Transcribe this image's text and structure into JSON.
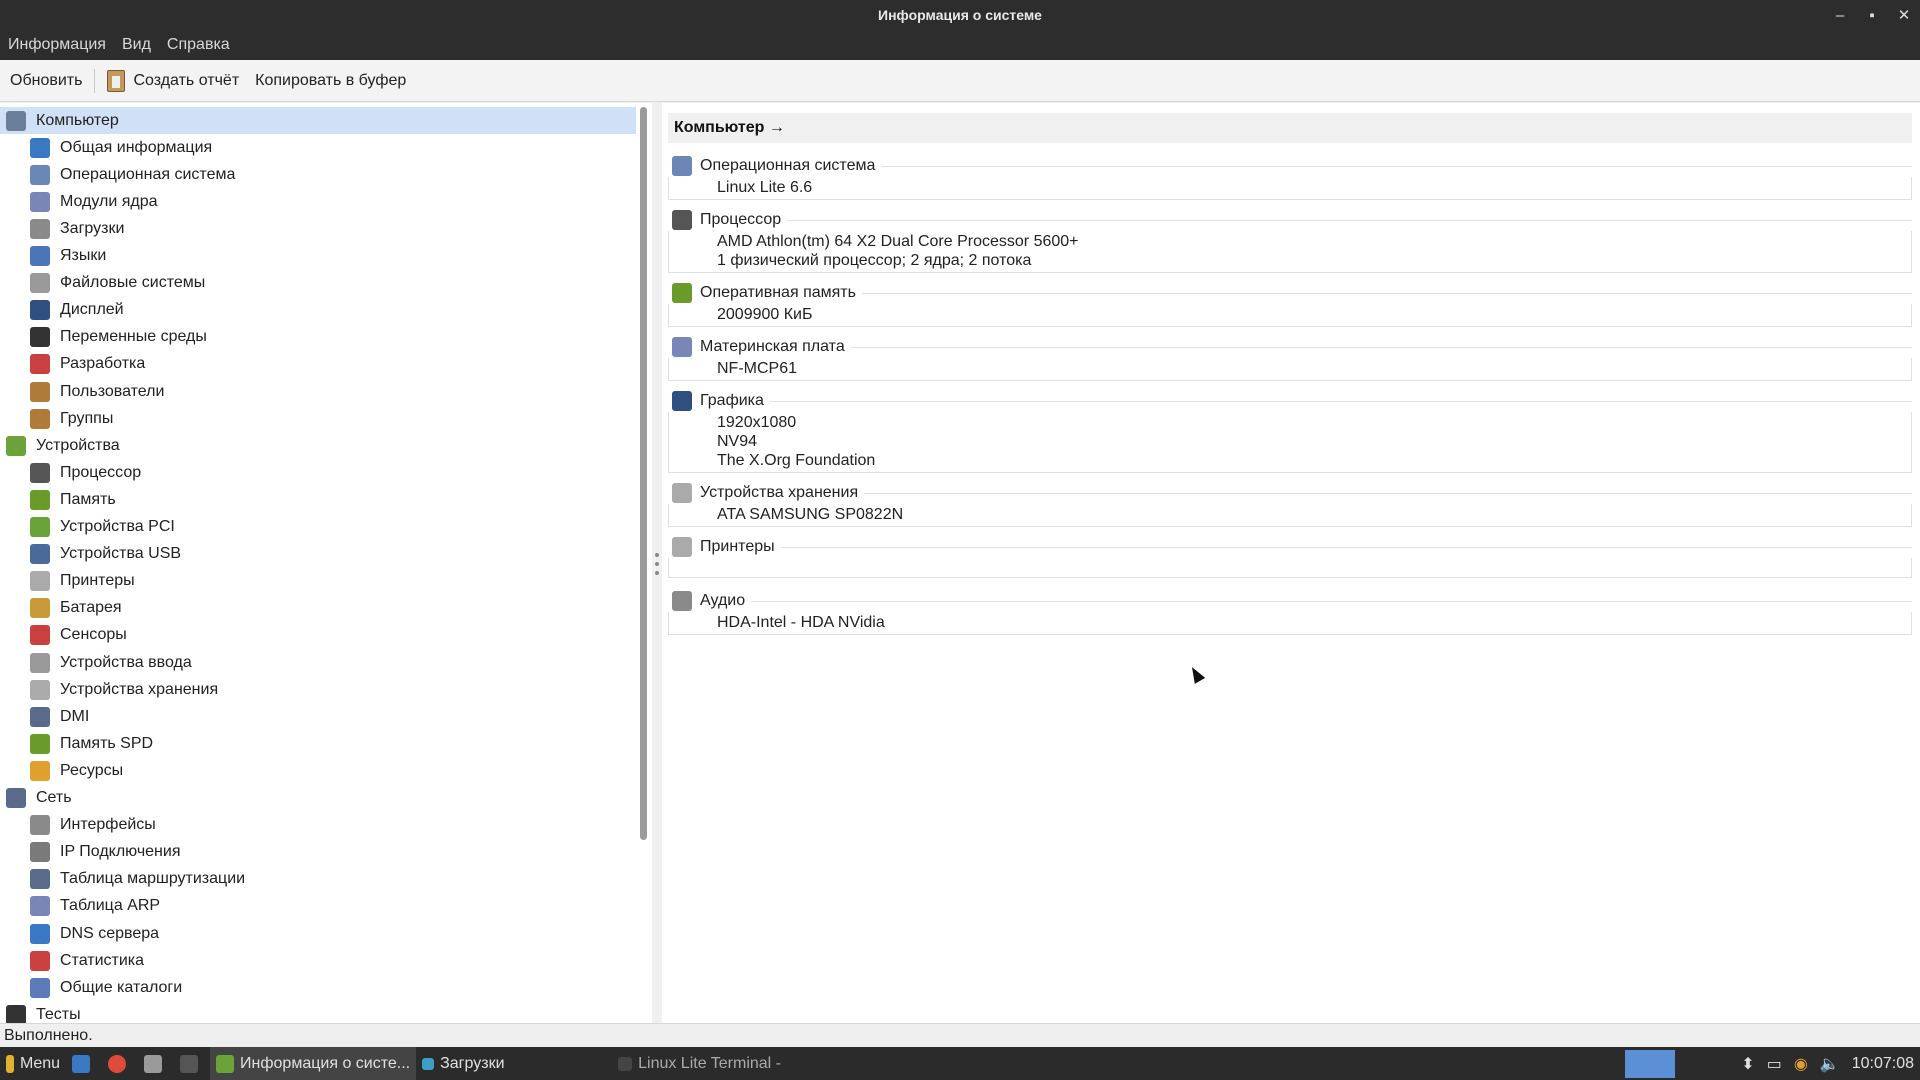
{
  "window": {
    "title": "Информация о системе"
  },
  "menu": [
    "Информация",
    "Вид",
    "Справка"
  ],
  "toolbar": {
    "refresh": "Обновить",
    "report": "Создать отчёт",
    "copy": "Копировать в буфер"
  },
  "tree": [
    {
      "label": "Компьютер",
      "level": 0,
      "icon": "computer-icon",
      "color": "#6b7f99",
      "selected": true
    },
    {
      "label": "Общая информация",
      "level": 1,
      "icon": "info-icon",
      "color": "#3b78c4"
    },
    {
      "label": "Операционная система",
      "level": 1,
      "icon": "gear-icon",
      "color": "#6a87b5"
    },
    {
      "label": "Модули ядра",
      "level": 1,
      "icon": "diamond-icon",
      "color": "#7a86b8"
    },
    {
      "label": "Загрузки",
      "level": 1,
      "icon": "power-icon",
      "color": "#8a8a8a"
    },
    {
      "label": "Языки",
      "level": 1,
      "icon": "flag-icon",
      "color": "#4a76b8"
    },
    {
      "label": "Файловые системы",
      "level": 1,
      "icon": "drive-icon",
      "color": "#9a9a9a"
    },
    {
      "label": "Дисплей",
      "level": 1,
      "icon": "monitor-icon",
      "color": "#2f4f80"
    },
    {
      "label": "Переменные среды",
      "level": 1,
      "icon": "terminal-icon",
      "color": "#333333"
    },
    {
      "label": "Разработка",
      "level": 1,
      "icon": "dev-icon",
      "color": "#c84040"
    },
    {
      "label": "Пользователи",
      "level": 1,
      "icon": "users-icon",
      "color": "#b07a3a"
    },
    {
      "label": "Группы",
      "level": 1,
      "icon": "groups-icon",
      "color": "#b07a3a"
    },
    {
      "label": "Устройства",
      "level": 0,
      "icon": "board-icon",
      "color": "#6aa33a"
    },
    {
      "label": "Процессор",
      "level": 1,
      "icon": "cpu-icon",
      "color": "#555555"
    },
    {
      "label": "Память",
      "level": 1,
      "icon": "memory-icon",
      "color": "#6a9a2a"
    },
    {
      "label": "Устройства PCI",
      "level": 1,
      "icon": "pci-icon",
      "color": "#6aa33a"
    },
    {
      "label": "Устройства USB",
      "level": 1,
      "icon": "usb-icon",
      "color": "#4a6a9a"
    },
    {
      "label": "Принтеры",
      "level": 1,
      "icon": "printer-icon",
      "color": "#aaaaaa"
    },
    {
      "label": "Батарея",
      "level": 1,
      "icon": "battery-icon",
      "color": "#c89a3a"
    },
    {
      "label": "Сенсоры",
      "level": 1,
      "icon": "thermometer-icon",
      "color": "#c84040"
    },
    {
      "label": "Устройства ввода",
      "level": 1,
      "icon": "input-icon",
      "color": "#9a9a9a"
    },
    {
      "label": "Устройства хранения",
      "level": 1,
      "icon": "storage-icon",
      "color": "#aaaaaa"
    },
    {
      "label": "DMI",
      "level": 1,
      "icon": "dmi-icon",
      "color": "#5a6a8a"
    },
    {
      "label": "Память SPD",
      "level": 1,
      "icon": "spd-icon",
      "color": "#6a9a2a"
    },
    {
      "label": "Ресурсы",
      "level": 1,
      "icon": "resources-icon",
      "color": "#e0a030"
    },
    {
      "label": "Сеть",
      "level": 0,
      "icon": "network-icon",
      "color": "#5a6a8a"
    },
    {
      "label": "Интерфейсы",
      "level": 1,
      "icon": "interfaces-icon",
      "color": "#8a8a8a"
    },
    {
      "label": "IP Подключения",
      "level": 1,
      "icon": "ip-icon",
      "color": "#7a7a7a"
    },
    {
      "label": "Таблица маршрутизации",
      "level": 1,
      "icon": "routing-icon",
      "color": "#5a6a8a"
    },
    {
      "label": "Таблица ARP",
      "level": 1,
      "icon": "arp-icon",
      "color": "#7a86b8"
    },
    {
      "label": "DNS сервера",
      "level": 1,
      "icon": "dns-icon",
      "color": "#3b78c4"
    },
    {
      "label": "Статистика",
      "level": 1,
      "icon": "stats-icon",
      "color": "#c84040"
    },
    {
      "label": "Общие каталоги",
      "level": 1,
      "icon": "shares-icon",
      "color": "#5a7ab8"
    },
    {
      "label": "Тесты",
      "level": 0,
      "icon": "benchmark-icon",
      "color": "#333333"
    }
  ],
  "details": {
    "header": "Компьютер →",
    "groups": [
      {
        "title": "Операционная система",
        "icon": "gear-icon",
        "color": "#6a87b5",
        "lines": [
          "Linux Lite 6.6"
        ]
      },
      {
        "title": "Процессор",
        "icon": "cpu-icon",
        "color": "#555555",
        "lines": [
          "AMD Athlon(tm) 64 X2 Dual Core Processor 5600+",
          "1 физический процессор; 2 ядра; 2 потока"
        ]
      },
      {
        "title": "Оперативная память",
        "icon": "memory-icon",
        "color": "#6a9a2a",
        "lines": [
          "2009900 КиБ"
        ]
      },
      {
        "title": "Материнская плата",
        "icon": "motherboard-icon",
        "color": "#7a86b8",
        "lines": [
          "NF-MCP61"
        ]
      },
      {
        "title": "Графика",
        "icon": "monitor-icon",
        "color": "#2f4f80",
        "lines": [
          "1920x1080",
          "NV94",
          "The X.Org Foundation"
        ]
      },
      {
        "title": "Устройства хранения",
        "icon": "storage-icon",
        "color": "#aaaaaa",
        "lines": [
          "ATA SAMSUNG SP0822N"
        ]
      },
      {
        "title": "Принтеры",
        "icon": "printer-icon",
        "color": "#aaaaaa",
        "lines": []
      },
      {
        "title": "Аудио",
        "icon": "audio-icon",
        "color": "#8a8a8a",
        "lines": [
          "HDA-Intel - HDA NVidia"
        ]
      }
    ]
  },
  "status": "Выполнено.",
  "taskbar": {
    "menu": "Menu",
    "tasks": [
      "Информация о систе...",
      "Загрузки",
      "Linux Lite Terminal -"
    ],
    "clock": "10:07:08"
  }
}
